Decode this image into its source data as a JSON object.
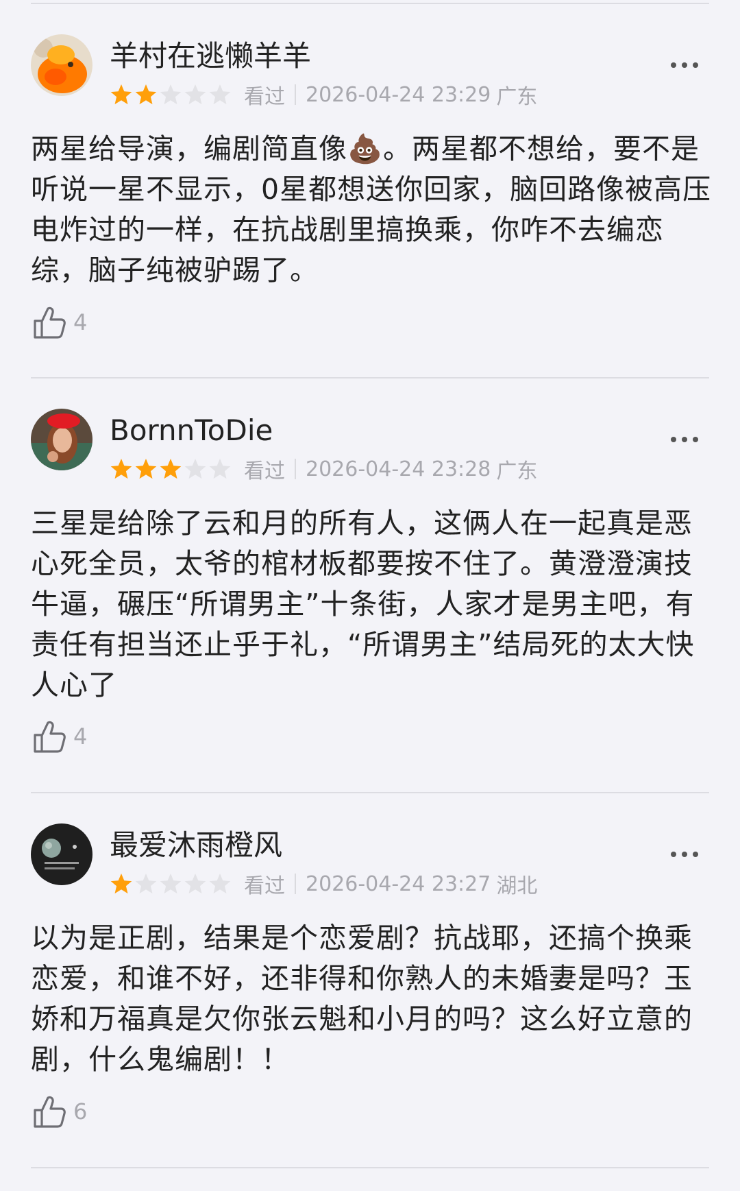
{
  "reviews": [
    {
      "username": "羊村在逃懒羊羊",
      "rating": 2,
      "max_rating": 5,
      "status": "看过",
      "time": "2026-04-24 23:29",
      "location": "广东",
      "content": "两星给导演，编剧简直像💩。两星都不想给，要不是听说一星不显示，0星都想送你回家，脑回路像被高压电炸过的一样，在抗战剧里搞换乘，你咋不去编恋综，脑子纯被驴踢了。",
      "likes": "4",
      "avatar_icon": "orange-cartoon-avatar"
    },
    {
      "username": "BornnToDie",
      "rating": 3,
      "max_rating": 5,
      "status": "看过",
      "time": "2026-04-24 23:28",
      "location": "广东",
      "content": "三星是给除了云和月的所有人，这俩人在一起真是恶心死全员，太爷的棺材板都要按不住了。黄澄澄演技牛逼，碾压“所谓男主”十条街，人家才是男主吧，有责任有担当还止乎于礼，“所谓男主”结局死的太大快人心了",
      "likes": "4",
      "avatar_icon": "red-beret-portrait-avatar"
    },
    {
      "username": "最爱沐雨橙风",
      "rating": 1,
      "max_rating": 5,
      "status": "看过",
      "time": "2026-04-24 23:27",
      "location": "湖北",
      "content": "以为是正剧，结果是个恋爱剧？抗战耶，还搞个换乘恋爱，和谁不好，还非得和你熟人的未婚妻是吗？玉娇和万福真是欠你张云魁和小月的吗？这么好立意的剧，什么鬼编剧！！",
      "likes": "6",
      "avatar_icon": "dark-moon-avatar"
    }
  ],
  "colors": {
    "star_filled": "#ff9f0a",
    "star_empty": "#e2e2e6",
    "meta_text": "#a8a8ae",
    "background": "#f3f3f8"
  }
}
